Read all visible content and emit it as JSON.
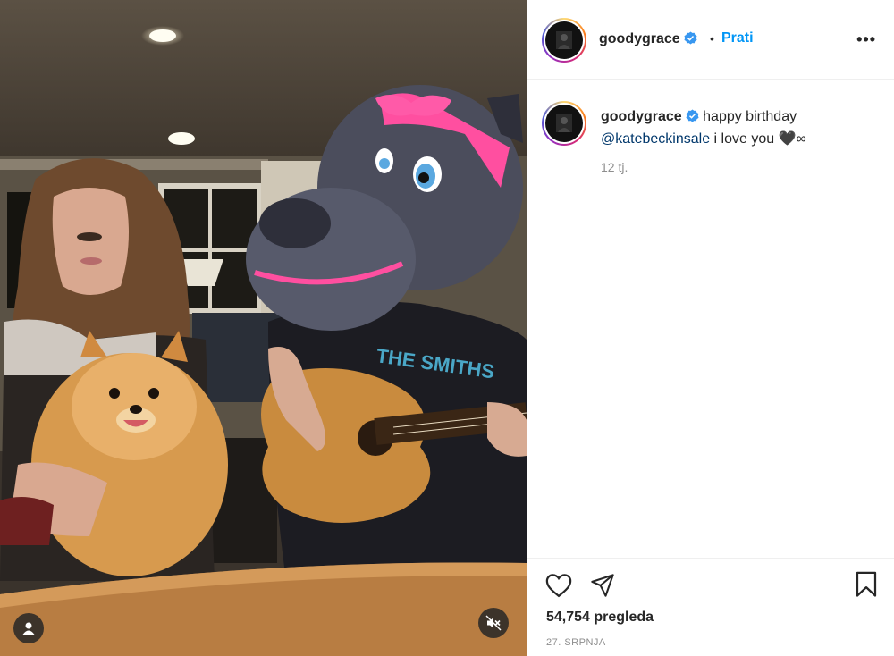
{
  "post": {
    "username": "goodygrace",
    "follow_label": "Prati",
    "separator": "•",
    "more_label": "•••",
    "caption_text": "happy birthday",
    "caption_mention": "@katebeckinsale",
    "caption_rest": "i love you 🖤∞",
    "time_ago": "12 tj.",
    "views": "54,754 pregleda",
    "date": "27. SRPNJA"
  },
  "media": {
    "shirt_text": "THE SMITHS"
  },
  "icons": {
    "verified": "verified-badge-icon",
    "like": "heart-icon",
    "share": "paper-plane-icon",
    "save": "bookmark-icon",
    "tag": "user-tag-icon",
    "mute": "muted-speaker-icon",
    "more": "more-options-icon"
  },
  "colors": {
    "accent": "#0095f6",
    "verified": "#3897f0",
    "mention": "#00376b",
    "text": "#262626",
    "secondary": "#8e8e8e"
  }
}
